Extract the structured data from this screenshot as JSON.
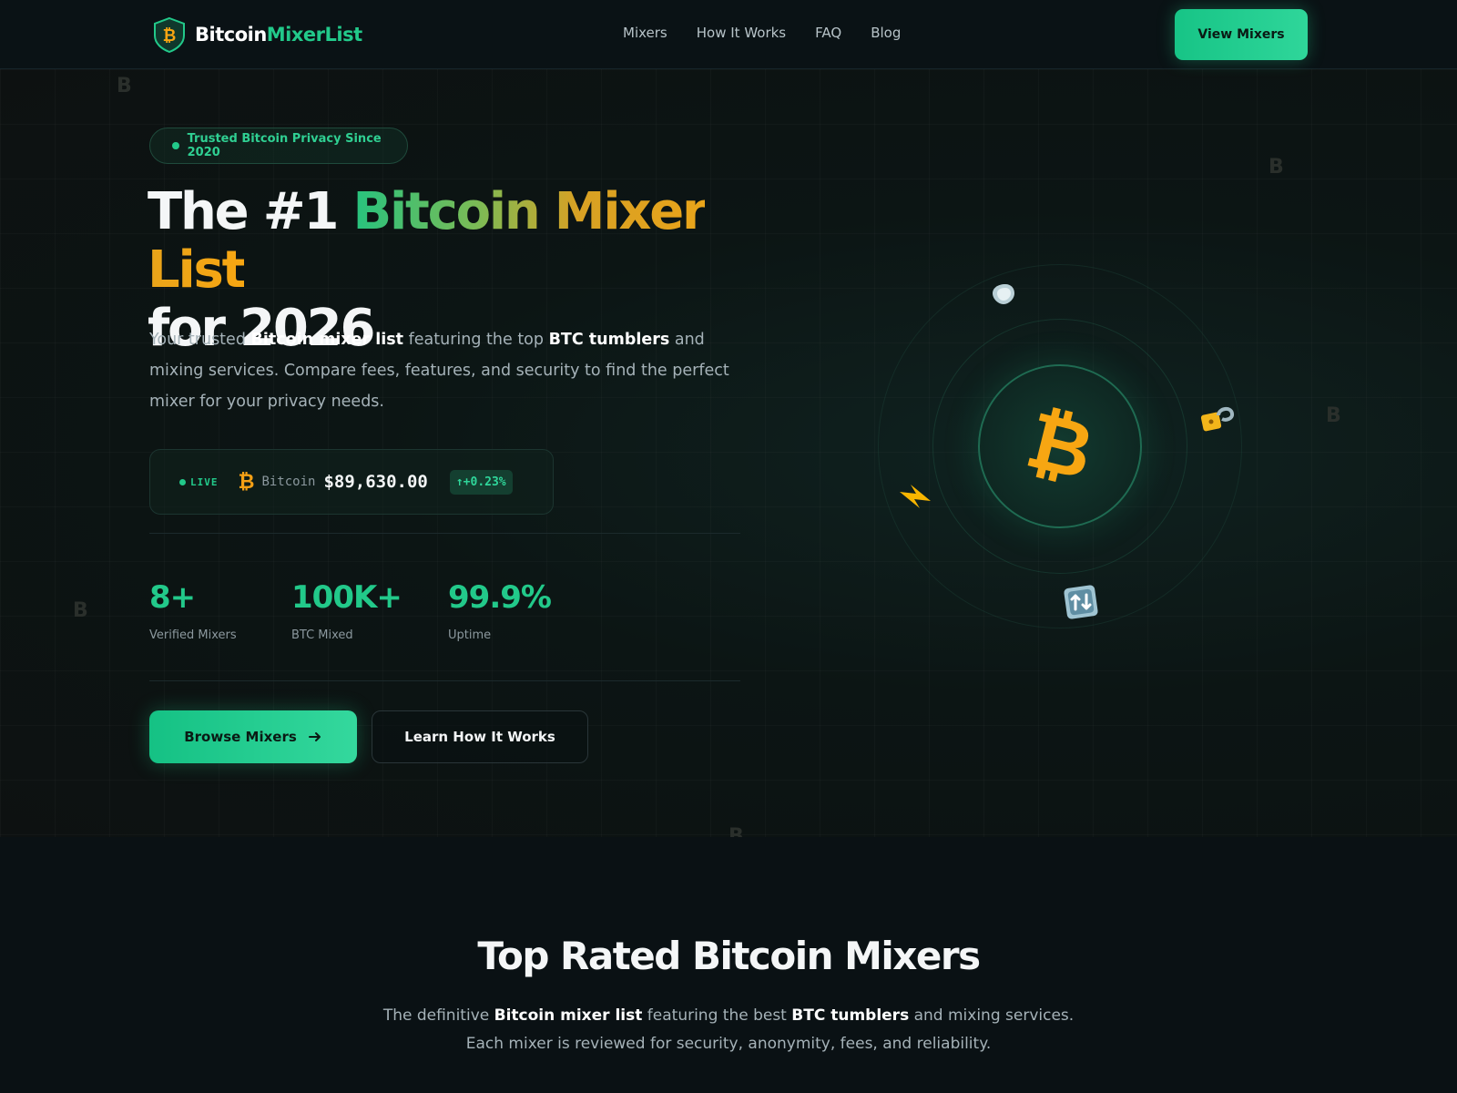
{
  "header": {
    "logo_part1": "Bitcoin",
    "logo_part2": "MixerList",
    "nav": [
      "Mixers",
      "How It Works",
      "FAQ",
      "Blog"
    ],
    "cta": "View Mixers"
  },
  "hero": {
    "badge": "Trusted Bitcoin Privacy Since 2020",
    "title_prefix": "The #1 ",
    "title_highlight": "Bitcoin Mixer List",
    "title_suffix": "for 2026",
    "lead": {
      "t1": "Your trusted ",
      "b1": "Bitcoin mixer list",
      "t2": " featuring the top ",
      "b2": "BTC tumblers",
      "t3": " and mixing services. Compare fees, features, and security to find the perfect mixer for your privacy needs."
    },
    "ticker": {
      "live": "LIVE",
      "symbol": "₿",
      "coin": "Bitcoin",
      "price": "$89,630.00",
      "change": "↑+0.23%"
    },
    "stats": [
      {
        "value": "8+",
        "label": "Verified Mixers"
      },
      {
        "value": "100K+",
        "label": "BTC Mixed"
      },
      {
        "value": "99.9%",
        "label": "Uptime"
      }
    ],
    "primary_button": "Browse Mixers",
    "primary_button_icon": "arrow-right-icon",
    "secondary_button": "Learn How It Works",
    "illustration_icons": [
      "bitcoin-icon",
      "shield-icon",
      "lock-icon",
      "lightning-icon",
      "exchange-icon"
    ]
  },
  "section": {
    "title": "Top Rated Bitcoin Mixers",
    "text": {
      "t1": "The definitive ",
      "b1": "Bitcoin mixer list",
      "t2": " featuring the best ",
      "b2": "BTC tumblers",
      "t3": " and mixing services. Each mixer is reviewed for security, anonymity, fees, and reliability."
    }
  },
  "colors": {
    "accent_green": "#22c98a",
    "accent_orange": "#f7a612",
    "background": "#0a1114"
  }
}
